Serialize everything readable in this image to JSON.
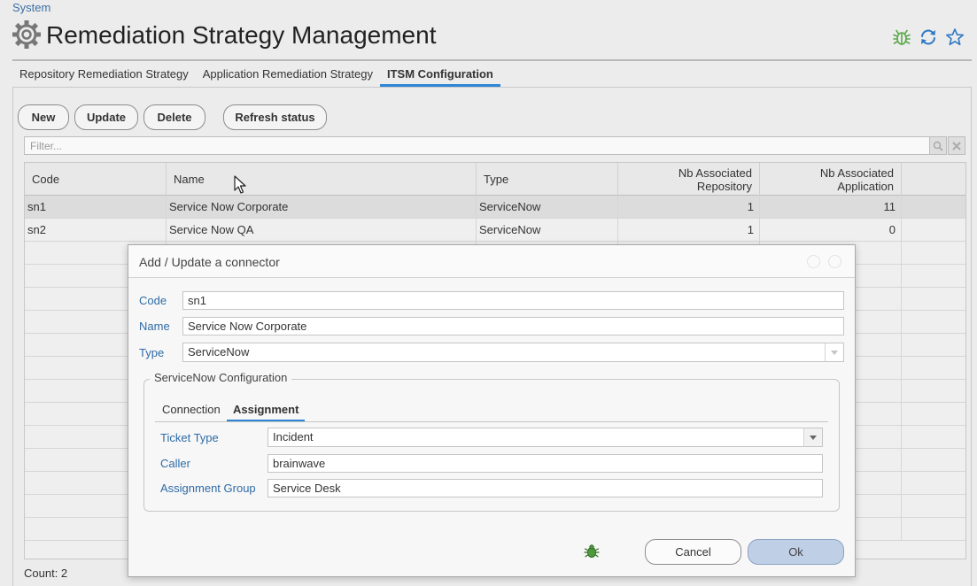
{
  "breadcrumb": "System",
  "page_title": "Remediation Strategy Management",
  "tabs": [
    {
      "label": "Repository Remediation Strategy"
    },
    {
      "label": "Application Remediation Strategy"
    },
    {
      "label": "ITSM Configuration",
      "active": true
    }
  ],
  "toolbar": {
    "new_label": "New",
    "update_label": "Update",
    "delete_label": "Delete",
    "refresh_label": "Refresh status"
  },
  "filter": {
    "placeholder": "Filter..."
  },
  "grid": {
    "columns": {
      "code": "Code",
      "name": "Name",
      "type": "Type",
      "nb_repo_line1": "Nb Associated",
      "nb_repo_line2": "Repository",
      "nb_app_line1": "Nb Associated",
      "nb_app_line2": "Application"
    },
    "rows": [
      {
        "code": "sn1",
        "name": "Service Now Corporate",
        "type": "ServiceNow",
        "nb_repository": "1",
        "nb_application": "11"
      },
      {
        "code": "sn2",
        "name": "Service Now QA",
        "type": "ServiceNow",
        "nb_repository": "1",
        "nb_application": "0"
      }
    ]
  },
  "count_label": "Count: 2",
  "dialog": {
    "title": "Add / Update a connector",
    "code_label": "Code",
    "code_value": "sn1",
    "name_label": "Name",
    "name_value": "Service Now Corporate",
    "type_label": "Type",
    "type_value": "ServiceNow",
    "config_legend": "ServiceNow Configuration",
    "config_tabs": [
      {
        "label": "Connection"
      },
      {
        "label": "Assignment",
        "active": true
      }
    ],
    "ticket_type_label": "Ticket Type",
    "ticket_type_value": "Incident",
    "caller_label": "Caller",
    "caller_value": "brainwave",
    "assignment_group_label": "Assignment Group",
    "assignment_group_value": "Service Desk",
    "cancel_label": "Cancel",
    "ok_label": "Ok"
  },
  "icons": {
    "title": "gear-icon",
    "debug": "bug-icon",
    "refresh": "refresh-icon",
    "favorite": "star-icon"
  },
  "colors": {
    "accent": "#2f86d6",
    "label_blue": "#2e6ba6",
    "bug_green": "#5aa84a",
    "ok_button": "#bfcfe6"
  }
}
